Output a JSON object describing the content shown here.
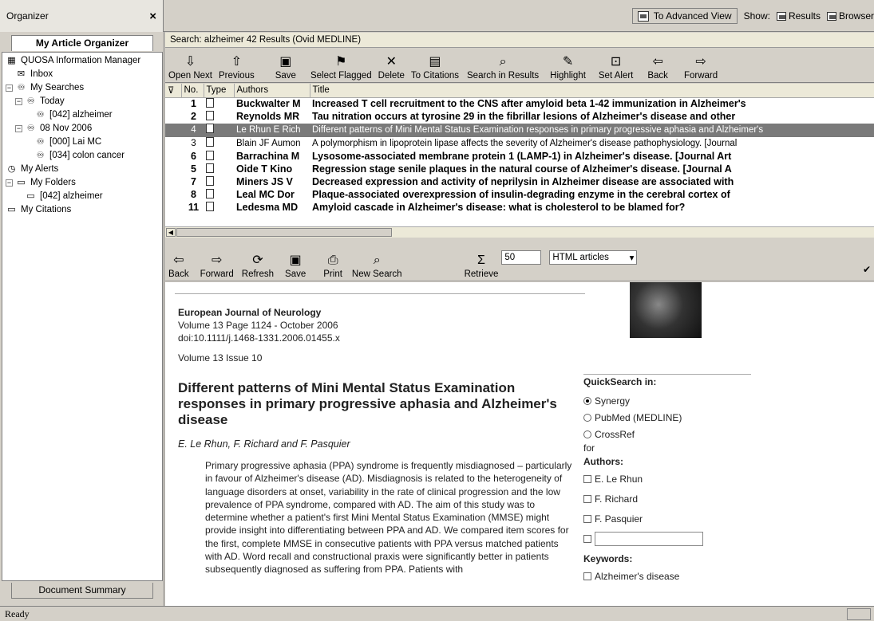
{
  "organizer": {
    "title": "Organizer",
    "close": "×",
    "tab_top": "My Article Organizer",
    "tab_bottom": "Document Summary"
  },
  "topbar": {
    "advanced_view": "To Advanced View",
    "show_label": "Show:",
    "results_label": "Results",
    "browser_label": "Browser"
  },
  "tree": [
    {
      "label": "QUOSA Information Manager",
      "icon": "app-icon",
      "indent": 0,
      "exp": ""
    },
    {
      "label": "Inbox",
      "icon": "inbox-icon",
      "indent": 1,
      "exp": ""
    },
    {
      "label": "My Searches",
      "icon": "binoculars-icon",
      "indent": 0,
      "exp": "−"
    },
    {
      "label": "Today",
      "icon": "binoculars-icon",
      "indent": 1,
      "exp": "−"
    },
    {
      "label": "[042] alzheimer",
      "icon": "binoculars-icon",
      "indent": 3,
      "exp": ""
    },
    {
      "label": "08 Nov 2006",
      "icon": "binoculars-icon",
      "indent": 1,
      "exp": "−"
    },
    {
      "label": "[000] Lai MC",
      "icon": "binoculars-icon",
      "indent": 3,
      "exp": ""
    },
    {
      "label": "[034] colon cancer",
      "icon": "binoculars-icon",
      "indent": 3,
      "exp": ""
    },
    {
      "label": "My Alerts",
      "icon": "clock-icon",
      "indent": 0,
      "exp": ""
    },
    {
      "label": "My Folders",
      "icon": "folder-icon",
      "indent": 0,
      "exp": "−"
    },
    {
      "label": "[042] alzheimer",
      "icon": "folder-icon",
      "indent": 2,
      "exp": ""
    },
    {
      "label": "My Citations",
      "icon": "folder-icon",
      "indent": 0,
      "exp": ""
    }
  ],
  "search_header": "Search: alzheimer  42  Results (Ovid MEDLINE)",
  "toolbar1": [
    {
      "label": "Open Next",
      "glyph": "⇩",
      "icon": "open-next-icon"
    },
    {
      "label": "Previous",
      "glyph": "⇧",
      "icon": "previous-icon"
    },
    {
      "label": "Save",
      "glyph": "▣",
      "icon": "save-icon"
    },
    {
      "label": "Select Flagged",
      "glyph": "⚑",
      "icon": "flag-icon"
    },
    {
      "label": "Delete",
      "glyph": "✕",
      "icon": "delete-icon"
    },
    {
      "label": "To Citations",
      "glyph": "▤",
      "icon": "citations-icon"
    },
    {
      "label": "Search in Results",
      "glyph": "⌕",
      "icon": "search-results-icon"
    },
    {
      "label": "Highlight",
      "glyph": "✎",
      "icon": "highlight-icon"
    },
    {
      "label": "Set Alert",
      "glyph": "⊡",
      "icon": "alert-icon"
    },
    {
      "label": "Back",
      "glyph": "⇦",
      "icon": "back-icon"
    },
    {
      "label": "Forward",
      "glyph": "⇨",
      "icon": "forward-icon"
    }
  ],
  "results": {
    "columns": [
      "",
      "No.",
      "Type",
      "Authors",
      "Title"
    ],
    "rows": [
      {
        "no": "1",
        "author": "Buckwalter M",
        "title": "Increased T cell recruitment to the CNS after amyloid beta 1-42 immunization in Alzheimer's",
        "style": "bold"
      },
      {
        "no": "2",
        "author": "Reynolds MR",
        "title": "Tau nitration occurs at tyrosine 29 in the fibrillar lesions of Alzheimer's disease and other",
        "style": "bold"
      },
      {
        "no": "4",
        "author": "Le Rhun E Rich",
        "title": "Different patterns of Mini Mental Status Examination responses in primary progressive aphasia and Alzheimer's",
        "style": "sel"
      },
      {
        "no": "3",
        "author": "Blain JF Aumon",
        "title": "A polymorphism in lipoprotein lipase affects the severity of Alzheimer's disease pathophysiology. [Journal",
        "style": "light"
      },
      {
        "no": "6",
        "author": "Barrachina M",
        "title": "Lysosome-associated membrane protein 1 (LAMP-1) in Alzheimer's disease. [Journal Art",
        "style": "bold"
      },
      {
        "no": "5",
        "author": "Oide T Kino",
        "title": "Regression stage senile plaques in the natural course of Alzheimer's disease. [Journal A",
        "style": "bold"
      },
      {
        "no": "7",
        "author": "Miners JS V",
        "title": "Decreased expression and activity of neprilysin in Alzheimer disease are associated with",
        "style": "bold"
      },
      {
        "no": "8",
        "author": "Leal MC Dor",
        "title": "Plaque-associated overexpression of insulin-degrading enzyme in the cerebral cortex of",
        "style": "bold"
      },
      {
        "no": "11",
        "author": "Ledesma MD",
        "title": "Amyloid cascade in Alzheimer's disease: what is cholesterol to be blamed for?",
        "style": "bold"
      }
    ]
  },
  "toolbar2": [
    {
      "label": "Back",
      "glyph": "⇦",
      "icon": "back-icon"
    },
    {
      "label": "Forward",
      "glyph": "⇨",
      "icon": "forward-icon"
    },
    {
      "label": "Refresh",
      "glyph": "⟳",
      "icon": "refresh-icon"
    },
    {
      "label": "Save",
      "glyph": "▣",
      "icon": "save-icon"
    },
    {
      "label": "Print",
      "glyph": "⎙",
      "icon": "print-icon"
    },
    {
      "label": "New Search",
      "glyph": "⌕",
      "icon": "new-search-icon"
    },
    {
      "label": "Retrieve",
      "glyph": "Σ",
      "icon": "sigma-icon"
    }
  ],
  "retrieve_count": "50",
  "retrieve_format": "HTML articles",
  "checkmark": "✔",
  "article": {
    "journal": "European Journal of Neurology",
    "volume_page": "Volume 13 Page 1124 - October 2006",
    "doi": "doi:10.1111/j.1468-1331.2006.01455.x",
    "issue": "Volume 13 Issue 10",
    "title": "Different patterns of Mini Mental Status Examination responses in primary progressive aphasia and Alzheimer's disease",
    "authors": "E. Le Rhun, F. Richard and F. Pasquier",
    "abstract": "Primary progressive aphasia (PPA) syndrome is frequently misdiagnosed – particularly in favour of Alzheimer's disease (AD). Misdiagnosis is related to the heterogeneity of language disorders at onset, variability in the rate of clinical progression and the low prevalence of PPA syndrome, compared with AD. The aim of this study was to determine whether a patient's first Mini Mental Status Examination (MMSE) might provide insight into differentiating between PPA and AD. We compared item scores for the first, complete MMSE in consecutive patients with PPA versus matched patients with AD. Word recall and constructional praxis were significantly better in patients subsequently diagnosed as suffering from PPA. Patients with"
  },
  "quicksearch": {
    "heading": "QuickSearch in:",
    "options": [
      "Synergy",
      "PubMed (MEDLINE)",
      "CrossRef"
    ],
    "for": "for",
    "authors_heading": "Authors:",
    "authors": [
      "E. Le Rhun",
      "F. Richard",
      "F. Pasquier"
    ],
    "keywords_heading": "Keywords:",
    "keyword": "Alzheimer's disease"
  },
  "status": "Ready"
}
